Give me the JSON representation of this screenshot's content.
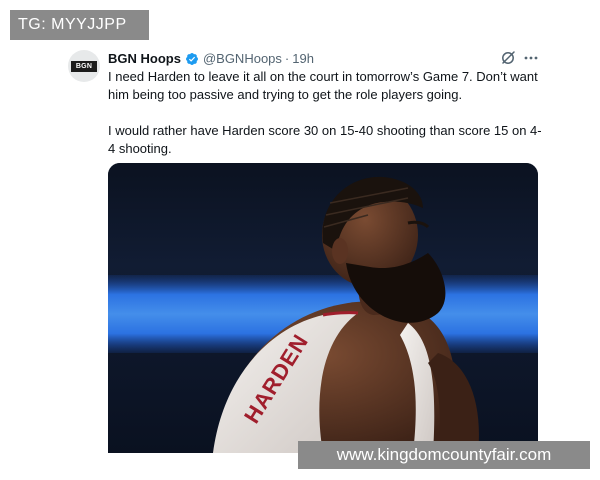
{
  "watermarks": {
    "top": "TG: MYYJJPP",
    "bottom": "www.kingdomcountyfair.com"
  },
  "tweet": {
    "avatar_text": "BGN",
    "display_name": "BGN Hoops",
    "handle": "@BGNHoops",
    "separator": "·",
    "time": "19h",
    "paragraphs": [
      "I need Harden to leave it all on the court in tomorrow’s Game 7. Don’t want him being too passive and trying to get the role players going.",
      "I would rather have Harden score 30 on 15-40 shooting than score 15 on 4-4 shooting."
    ],
    "media": {
      "jersey_text": "HARDEN",
      "alt": "photo"
    }
  },
  "icons": {
    "verified": "verified-badge-icon",
    "grok": "grok-icon",
    "more": "more-options-icon"
  },
  "colors": {
    "verified_blue": "#1d9bf0",
    "secondary_text": "#536471",
    "primary_text": "#0f1419",
    "watermark_bg": "#8a8a8a"
  }
}
